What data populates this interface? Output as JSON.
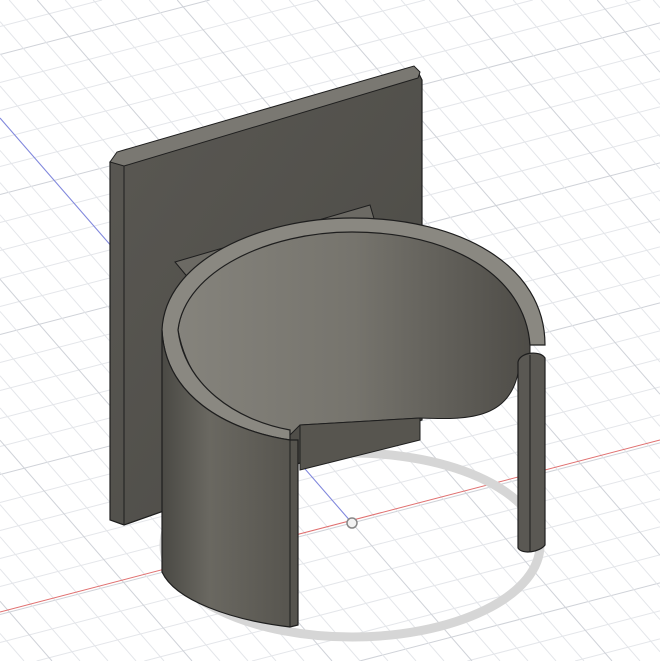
{
  "viewport": {
    "background_color": "#ffffff",
    "grid_minor_color": "#e4e6ea",
    "grid_major_color": "#cfd2d8",
    "x_axis_color": "#e07070",
    "z_axis_color": "#7f86e0",
    "model_color": "#5e5c56",
    "model_edge_color": "#1e1e1e",
    "shadow_color": "#d6d6d6"
  }
}
